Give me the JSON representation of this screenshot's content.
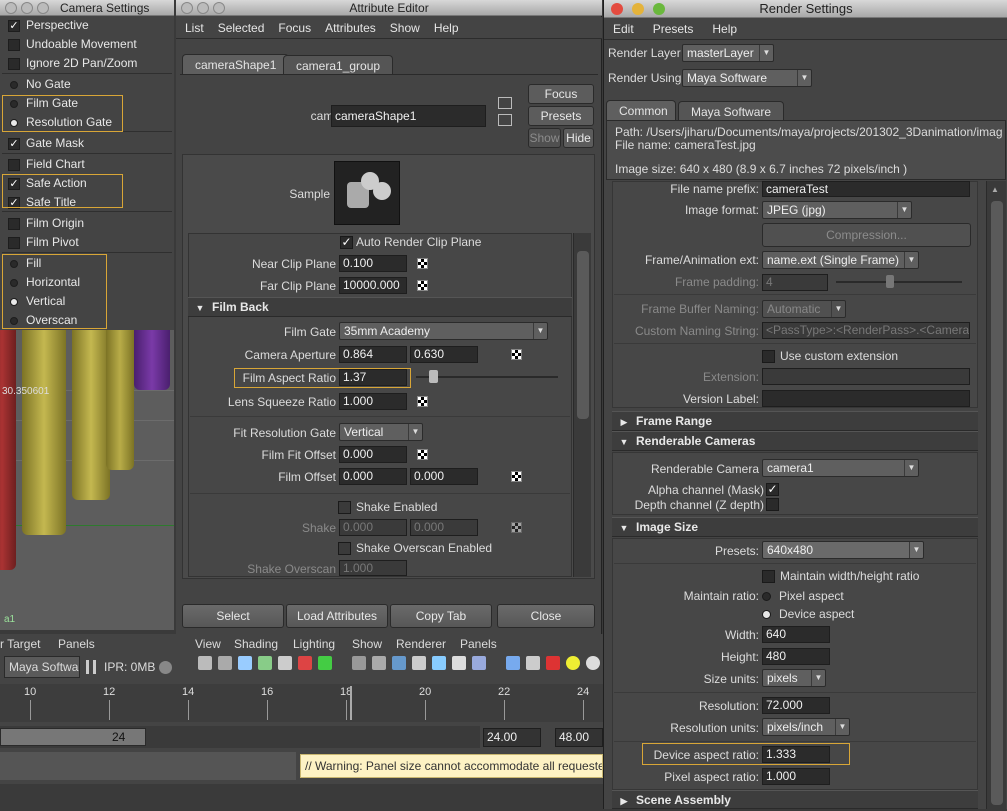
{
  "camera_settings": {
    "title": "Camera Settings",
    "items": [
      {
        "label": "Perspective",
        "type": "check",
        "checked": true
      },
      {
        "label": "Undoable Movement",
        "type": "check",
        "checked": false
      },
      {
        "label": "Ignore 2D Pan/Zoom",
        "type": "check",
        "checked": false
      },
      {
        "label": "No Gate",
        "type": "radio",
        "checked": false
      },
      {
        "label": "Film Gate",
        "type": "radio",
        "checked": false
      },
      {
        "label": "Resolution Gate",
        "type": "radio",
        "checked": true
      },
      {
        "label": "Gate Mask",
        "type": "check",
        "checked": true
      },
      {
        "label": "Field Chart",
        "type": "check",
        "checked": false
      },
      {
        "label": "Safe Action",
        "type": "check",
        "checked": true
      },
      {
        "label": "Safe Title",
        "type": "check",
        "checked": true
      },
      {
        "label": "Film Origin",
        "type": "check",
        "checked": false
      },
      {
        "label": "Film Pivot",
        "type": "check",
        "checked": false
      },
      {
        "label": "Fill",
        "type": "radio",
        "checked": false
      },
      {
        "label": "Horizontal",
        "type": "radio",
        "checked": false
      },
      {
        "label": "Vertical",
        "type": "radio",
        "checked": true
      },
      {
        "label": "Overscan",
        "type": "radio",
        "checked": false
      }
    ]
  },
  "viewport": {
    "coord": "30.350601",
    "label": "a1"
  },
  "attribute_editor": {
    "title": "Attribute Editor",
    "menu": [
      "List",
      "Selected",
      "Focus",
      "Attributes",
      "Show",
      "Help"
    ],
    "tabs": [
      "cameraShape1",
      "camera1_group"
    ],
    "camera_label": "camera:",
    "camera_value": "cameraShape1",
    "focus_btn": "Focus",
    "presets_btn": "Presets",
    "show_btn": "Show",
    "hide_btn": "Hide",
    "sample_label": "Sample",
    "auto_render_clip": "Auto Render Clip Plane",
    "near_clip_label": "Near Clip Plane",
    "near_clip": "0.100",
    "far_clip_label": "Far Clip Plane",
    "far_clip": "10000.000",
    "film_back_section": "Film Back",
    "film_gate_label": "Film Gate",
    "film_gate": "35mm Academy",
    "camera_aperture_label": "Camera Aperture",
    "aperture_x": "0.864",
    "aperture_y": "0.630",
    "film_aspect_label": "Film Aspect Ratio",
    "film_aspect": "1.37",
    "lens_squeeze_label": "Lens Squeeze Ratio",
    "lens_squeeze": "1.000",
    "fit_gate_label": "Fit Resolution Gate",
    "fit_gate": "Vertical",
    "film_fit_offset_label": "Film Fit Offset",
    "film_fit_offset": "0.000",
    "film_offset_label": "Film Offset",
    "film_offset_x": "0.000",
    "film_offset_y": "0.000",
    "shake_enabled": "Shake Enabled",
    "shake_label": "Shake",
    "shake_x": "0.000",
    "shake_y": "0.000",
    "shake_overscan_enabled": "Shake Overscan Enabled",
    "shake_overscan_label": "Shake Overscan",
    "shake_overscan": "1.000",
    "buttons": [
      "Select",
      "Load Attributes",
      "Copy Tab",
      "Close"
    ]
  },
  "bottom": {
    "panel_menu": [
      "r Target",
      "Panels"
    ],
    "viewport_menu": [
      "View",
      "Shading",
      "Lighting",
      "Show",
      "Renderer",
      "Panels"
    ],
    "renderer": "Maya Softwa",
    "ipr": "IPR: 0MB",
    "ticks": [
      "10",
      "12",
      "14",
      "16",
      "18",
      "20",
      "22",
      "24"
    ],
    "current_frame": "24",
    "range_end": "24.00",
    "range_max": "48.00",
    "warning": "// Warning: Panel size cannot accommodate all requested"
  },
  "render_settings": {
    "title": "Render Settings",
    "menu": [
      "Edit",
      "Presets",
      "Help"
    ],
    "render_layer_label": "Render Layer",
    "render_layer": "masterLayer",
    "render_using_label": "Render Using",
    "render_using": "Maya Software",
    "tabs": [
      "Common",
      "Maya Software"
    ],
    "path_line": "Path: /Users/jiharu/Documents/maya/projects/201302_3Danimation/imag",
    "file_line": "File name:  cameraTest.jpg",
    "image_size_line": "Image size: 640 x 480 (8.9 x 6.7 inches 72 pixels/inch )",
    "file_prefix_label": "File name prefix:",
    "file_prefix": "cameraTest",
    "image_format_label": "Image format:",
    "image_format": "JPEG (jpg)",
    "compression_btn": "Compression...",
    "frame_ext_label": "Frame/Animation ext:",
    "frame_ext": "name.ext (Single Frame)",
    "frame_padding_label": "Frame padding:",
    "frame_padding": "4",
    "frame_buffer_label": "Frame Buffer Naming:",
    "frame_buffer": "Automatic",
    "custom_naming_label": "Custom Naming String:",
    "custom_naming": "<PassType>:<RenderPass>.<Camera>",
    "use_custom_ext": "Use custom extension",
    "extension_label": "Extension:",
    "version_label": "Version Label:",
    "frame_range_section": "Frame Range",
    "renderable_cameras_section": "Renderable Cameras",
    "renderable_camera_label": "Renderable Camera",
    "renderable_camera": "camera1",
    "alpha_label": "Alpha channel (Mask)",
    "depth_label": "Depth channel (Z depth)",
    "image_size_section": "Image Size",
    "presets_label": "Presets:",
    "presets": "640x480",
    "maintain_wh": "Maintain width/height ratio",
    "maintain_ratio_label": "Maintain ratio:",
    "pixel_aspect_opt": "Pixel aspect",
    "device_aspect_opt": "Device aspect",
    "width_label": "Width:",
    "width": "640",
    "height_label": "Height:",
    "height": "480",
    "size_units_label": "Size units:",
    "size_units": "pixels",
    "resolution_label": "Resolution:",
    "resolution": "72.000",
    "resolution_units_label": "Resolution units:",
    "resolution_units": "pixels/inch",
    "device_aspect_label": "Device aspect ratio:",
    "device_aspect": "1.333",
    "pixel_aspect_label": "Pixel aspect ratio:",
    "pixel_aspect": "1.000",
    "scene_assembly_section": "Scene Assembly"
  },
  "colors": {
    "highlight": "#d8a637",
    "warning_bg": "#fdf2c4"
  }
}
